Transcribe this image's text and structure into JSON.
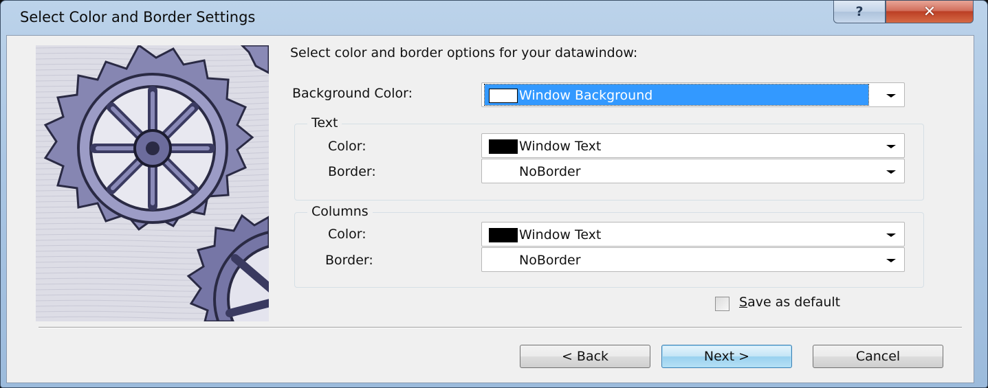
{
  "window": {
    "title": "Select Color and Border Settings",
    "help_label": "?",
    "close_label": "✕"
  },
  "prompt": "Select color and border options for your datawindow:",
  "background": {
    "label": "Background Color:",
    "value": "Window Background",
    "swatch_color": "#ffffff"
  },
  "text_group": {
    "legend": "Text",
    "color_label": "Color:",
    "color_value": "Window Text",
    "color_swatch": "#000000",
    "border_label": "Border:",
    "border_value": "NoBorder"
  },
  "columns_group": {
    "legend": "Columns",
    "color_label": "Color:",
    "color_value": "Window Text",
    "color_swatch": "#000000",
    "border_label": "Border:",
    "border_value": "NoBorder"
  },
  "save_default": {
    "label_first": "S",
    "label_rest": "ave as default",
    "checked": false
  },
  "buttons": {
    "back": "< Back",
    "next": "Next >",
    "cancel": "Cancel"
  },
  "icons": {
    "help": "help-icon",
    "close": "close-icon",
    "dropdown": "chevron-down-icon",
    "art": "gears-illustration"
  },
  "colors": {
    "selection": "#3399ff",
    "client": "#f0f0f0",
    "gear_tint": "#5a5a8c"
  }
}
